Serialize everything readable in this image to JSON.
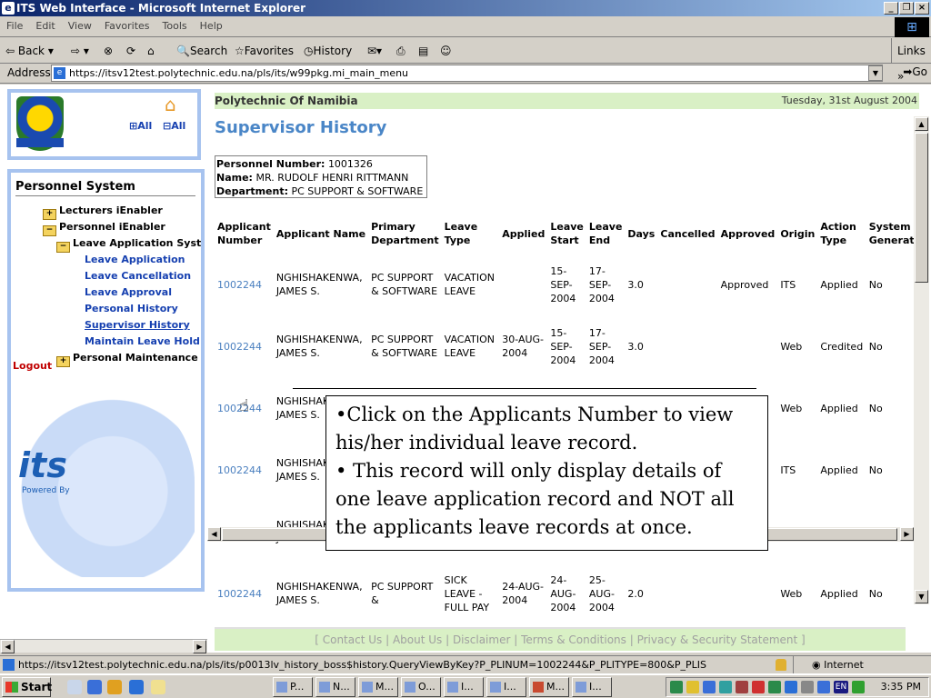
{
  "window": {
    "title": "ITS Web Interface - Microsoft Internet Explorer"
  },
  "menu": [
    "File",
    "Edit",
    "View",
    "Favorites",
    "Tools",
    "Help"
  ],
  "toolbar": {
    "back": "Back",
    "search": "Search",
    "favorites": "Favorites",
    "history": "History",
    "links": "Links",
    "go": "Go"
  },
  "address": {
    "label": "Address",
    "url": "https://itsv12test.polytechnic.edu.na/pls/its/w99pkg.mi_main_menu"
  },
  "sidebar": {
    "expand_all": "All",
    "collapse_all": "All",
    "title": "Personnel System",
    "items": [
      {
        "label": "Lecturers iEnabler",
        "level": 1
      },
      {
        "label": "Personnel iEnabler",
        "level": 1
      },
      {
        "label": "Leave Application System",
        "level": 2
      },
      {
        "label": "Leave Application",
        "level": 3
      },
      {
        "label": "Leave Cancellation",
        "level": 3
      },
      {
        "label": "Leave Approval",
        "level": 3
      },
      {
        "label": "Personal History",
        "level": 3
      },
      {
        "label": "Supervisor History",
        "level": 3
      },
      {
        "label": "Maintain Leave Hold",
        "level": 3
      },
      {
        "label": "Personal Maintenance",
        "level": 1
      }
    ],
    "logout": "Logout",
    "powered_by": "Powered By",
    "brand": "its"
  },
  "header": {
    "org": "Polytechnic Of Namibia",
    "date": "Tuesday, 31st August 2004"
  },
  "page_title": "Supervisor History",
  "personnel": {
    "number_label": "Personnel Number:",
    "number": "1001326",
    "name_label": "Name:",
    "name": "MR. RUDOLF HENRI RITTMANN",
    "dept_label": "Department:",
    "dept": "PC SUPPORT & SOFTWARE"
  },
  "table": {
    "headers": [
      "Applicant Number",
      "Applicant Name",
      "Primary Department",
      "Leave Type",
      "Applied",
      "Leave Start",
      "Leave End",
      "Days",
      "Cancelled",
      "Approved",
      "Origin",
      "Action Type",
      "System Generated"
    ],
    "rows": [
      [
        "1002244",
        "NGHISHAKENWA, JAMES S.",
        "PC SUPPORT & SOFTWARE",
        "VACATION LEAVE",
        "",
        "15-SEP-2004",
        "17-SEP-2004",
        "3.0",
        "",
        "Approved",
        "ITS",
        "Applied",
        "No"
      ],
      [
        "1002244",
        "NGHISHAKENWA, JAMES S.",
        "PC SUPPORT & SOFTWARE",
        "VACATION LEAVE",
        "30-AUG-2004",
        "15-SEP-2004",
        "17-SEP-2004",
        "3.0",
        "",
        "",
        "Web",
        "Credited",
        "No"
      ],
      [
        "1002244",
        "NGHISHAKENWA, JAMES S.",
        "PC SUPPORT",
        "",
        "31-",
        "06-",
        "10-",
        "",
        "",
        "",
        "Web",
        "Applied",
        "No"
      ],
      [
        "1002244",
        "NGHISHAKENWA, JAMES S.",
        "",
        "",
        "",
        "",
        "",
        "",
        "",
        "",
        "ITS",
        "Applied",
        "No"
      ],
      [
        "1002244",
        "NGHISHAKENWA, JAMES S.",
        "SOFTWARE",
        "",
        "",
        "",
        "",
        "",
        "",
        "",
        "Web",
        "Credited",
        "No"
      ],
      [
        "1002244",
        "NGHISHAKENWA, JAMES S.",
        "PC SUPPORT &",
        "SICK LEAVE - FULL PAY",
        "24-AUG-2004",
        "24-AUG-2004",
        "25-AUG-2004",
        "2.0",
        "",
        "",
        "Web",
        "Applied",
        "No"
      ]
    ]
  },
  "footer": "[ Contact Us | About Us | Disclaimer | Terms & Conditions | Privacy & Security Statement ]",
  "callout": {
    "line1": "•Click on the Applicants Number to view his/her individual leave record.",
    "line2": "• This record will only display details of one leave application record and NOT all the applicants leave records at once."
  },
  "status": {
    "url": "https://itsv12test.polytechnic.edu.na/pls/its/p0013lv_history_boss$history.QueryViewByKey?P_PLINUM=1002244&P_PLITYPE=800&P_PLIS",
    "zone": "Internet"
  },
  "taskbar": {
    "start": "Start",
    "tasks": [
      "P...",
      "N...",
      "M...",
      "O...",
      "I...",
      "I...",
      "M...",
      "I..."
    ],
    "clock": "3:35 PM",
    "lang": "EN"
  }
}
